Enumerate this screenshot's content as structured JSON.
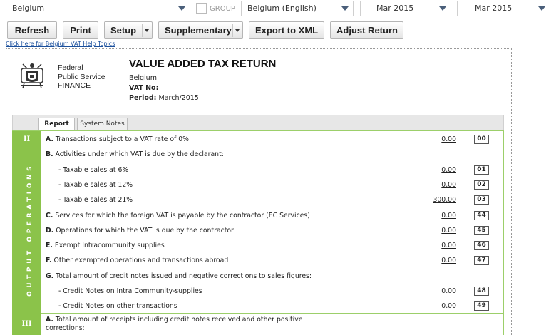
{
  "selectors": {
    "country": "Belgium",
    "group_label": "GROUP",
    "language": "Belgium (English)",
    "period_from": "Mar 2015",
    "period_to": "Mar 2015"
  },
  "toolbar": {
    "refresh": "Refresh",
    "print": "Print",
    "setup": "Setup",
    "supplementary": "Supplementary",
    "export_xml": "Export to XML",
    "adjust_return": "Adjust Return"
  },
  "help_link": "Click here for Belgium VAT Help Topics",
  "header": {
    "logo_lines": [
      "Federal",
      "Public Service",
      "FINANCE"
    ],
    "title": "VALUE ADDED TAX RETURN",
    "country": "Belgium",
    "vat_no_label": "VAT No:",
    "period_label": "Period:",
    "period_value": "March/2015"
  },
  "tabs": [
    "Report",
    "System Notes"
  ],
  "section_ii": {
    "number": "II",
    "vertical_label": "OUTPUT OPERATIONS",
    "rows": [
      {
        "prefix": "A.",
        "text": "Transactions subject to a VAT rate of 0%",
        "amount": "0.00",
        "code": "00"
      },
      {
        "prefix": "B.",
        "text": "Activities under which VAT is due by the declarant:",
        "amount": "",
        "code": ""
      },
      {
        "prefix": "",
        "text": "- Taxable sales at 6%",
        "amount": "0.00",
        "code": "01"
      },
      {
        "prefix": "",
        "text": "- Taxable sales at 12%",
        "amount": "0.00",
        "code": "02"
      },
      {
        "prefix": "",
        "text": "- Taxable sales at 21%",
        "amount": "300.00",
        "code": "03"
      },
      {
        "prefix": "C.",
        "text": "Services for which the foreign VAT is payable by the contractor (EC Services)",
        "amount": "0.00",
        "code": "44"
      },
      {
        "prefix": "D.",
        "text": "Operations for which the VAT is due by the contractor",
        "amount": "0.00",
        "code": "45"
      },
      {
        "prefix": "E.",
        "text": "Exempt Intracommunity supplies",
        "amount": "0.00",
        "code": "46"
      },
      {
        "prefix": "F.",
        "text": "Other exempted operations and transactions abroad",
        "amount": "0.00",
        "code": "47"
      },
      {
        "prefix": "G.",
        "text": "Total amount of credit notes issued and negative corrections to sales figures:",
        "amount": "",
        "code": ""
      },
      {
        "prefix": "",
        "text": "- Credit Notes on Intra Community-supplies",
        "amount": "0.00",
        "code": "48"
      },
      {
        "prefix": "",
        "text": "- Credit Notes on other transactions",
        "amount": "0.00",
        "code": "49"
      }
    ]
  },
  "section_iii": {
    "number": "III",
    "row_prefix": "A.",
    "row_text_1": "Total amount of receipts including credit notes received and other positive",
    "row_text_2": "corrections:"
  },
  "colors": {
    "section_green": "#8bc34a",
    "link_blue": "#1a4f9c",
    "caret_blue": "#4a5f7a"
  }
}
